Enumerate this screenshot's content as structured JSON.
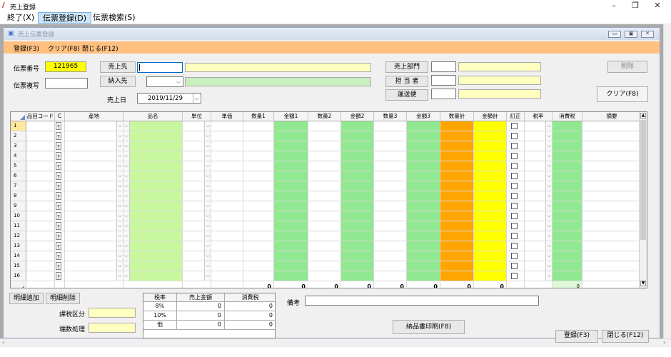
{
  "window": {
    "title": "売上登録"
  },
  "menu": [
    {
      "label": "終了(X)"
    },
    {
      "label": "伝票登録(D)"
    },
    {
      "label": "伝票検索(S)"
    }
  ],
  "child_window": {
    "title": "売上伝票登録"
  },
  "toolbar": {
    "register": "登録(F3)",
    "clear": "クリア(F8)",
    "close": "閉じる(F12)"
  },
  "header": {
    "denpyo_no_label": "伝票番号",
    "denpyo_no_value": "121965",
    "denpyo_copy_label": "伝票複写",
    "uriage_saki_btn": "売上先",
    "nonyu_saki_btn": "納入先",
    "uriage_date_label": "売上日",
    "uriage_date_value": "2019/11/29",
    "uriage_bumon_btn": "売上部門",
    "tantou_btn": "担 当 者",
    "unsou_btn": "運送便",
    "delete_btn": "削除",
    "clear_btn": "クリア(F8)"
  },
  "colors": {
    "toolbar": "#ffc080",
    "yellow": "#ffff00",
    "green": "#90e890",
    "orange": "#ffa500",
    "light_green": "#c9f7a0"
  },
  "grid": {
    "columns": [
      "品目コード",
      "C",
      "産地",
      "品名",
      "単位",
      "単価",
      "数量1",
      "金額1",
      "数量2",
      "金額2",
      "数量3",
      "金額3",
      "数量計",
      "金額計",
      "訂正",
      "税率",
      "消費税",
      "摘要"
    ],
    "row_numbers": [
      "1",
      "2",
      "3",
      "4",
      "5",
      "6",
      "7",
      "8",
      "9",
      "10",
      "11",
      "12",
      "13",
      "14",
      "15",
      "16"
    ],
    "totals": {
      "qty1": "0",
      "amt1": "0",
      "qty2": "0",
      "amt2": "0",
      "qty3": "0",
      "amt3": "0",
      "qty_total": "0",
      "amt_total": "0",
      "tax": "0"
    }
  },
  "bottom": {
    "add_line": "明細追加",
    "delete_line": "明細削除",
    "tax_class_label": "課税区分",
    "rounding_label": "端数処理",
    "tax_table": {
      "headers": [
        "税率",
        "売上金額",
        "消費税"
      ],
      "rows": [
        {
          "rate": "8%",
          "amount": "0",
          "tax": "0"
        },
        {
          "rate": "10%",
          "amount": "0",
          "tax": "0"
        },
        {
          "rate": "他",
          "amount": "0",
          "tax": "0"
        }
      ]
    },
    "remarks_label": "備考",
    "print_btn": "納品書印刷(F8)",
    "register_btn": "登録(F3)",
    "close_btn": "閉じる(F12)"
  }
}
